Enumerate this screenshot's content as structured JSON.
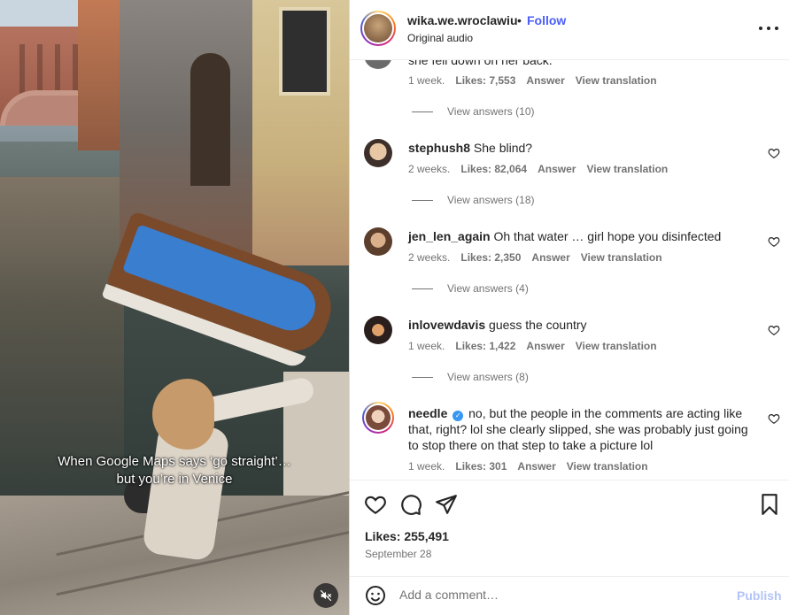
{
  "video": {
    "caption_line1": "When Google Maps says ‘go straight’…",
    "caption_line2": "but you’re in Venice",
    "mute_icon": "speaker-muted-icon"
  },
  "header": {
    "username": "wika.we.wroclawiu",
    "separator": "•",
    "follow_label": "Follow",
    "audio": "Original audio",
    "more_icon": "more-horizontal-icon"
  },
  "comments": {
    "partial": {
      "text": "she fell down on her back.",
      "time": "1 week.",
      "likes": "Likes: 7,553",
      "answer": "Answer",
      "translate": "View translation",
      "view_answers": "View answers (10)"
    },
    "items": [
      {
        "username": "stephush8",
        "text": "She blind?",
        "time": "2 weeks.",
        "likes": "Likes: 82,064",
        "answer": "Answer",
        "translate": "View translation",
        "view_answers": "View answers (18)"
      },
      {
        "username": "jen_len_again",
        "text": "Oh that water … girl hope you disinfected",
        "time": "2 weeks.",
        "likes": "Likes: 2,350",
        "answer": "Answer",
        "translate": "View translation",
        "view_answers": "View answers (4)"
      },
      {
        "username": "inlovewdavis",
        "text": "guess the country",
        "time": "1 week.",
        "likes": "Likes: 1,422",
        "answer": "Answer",
        "translate": "View translation",
        "view_answers": "View answers (8)"
      },
      {
        "username": "needle",
        "text": "no, but the people in the comments are acting like that, right? lol she clearly slipped, she was probably just going to stop there on that step to take a picture lol",
        "time": "1 week.",
        "likes": "Likes: 301",
        "answer": "Answer",
        "translate": "View translation",
        "verified_mark": "✓"
      }
    ]
  },
  "actions": {
    "like_icon": "heart-icon",
    "comment_icon": "comment-bubble-icon",
    "share_icon": "send-paper-plane-icon",
    "save_icon": "bookmark-icon",
    "likes": "Likes: 255,491",
    "date": "September 28"
  },
  "add_comment": {
    "emoji_icon": "emoji-smile-icon",
    "placeholder": "Add a comment…",
    "publish_label": "Publish"
  },
  "colors": {
    "accent_blue": "#4a5df9",
    "publish_disabled": "#b3c4f8",
    "muted_text": "#737373",
    "verified_blue": "#3897f0"
  }
}
